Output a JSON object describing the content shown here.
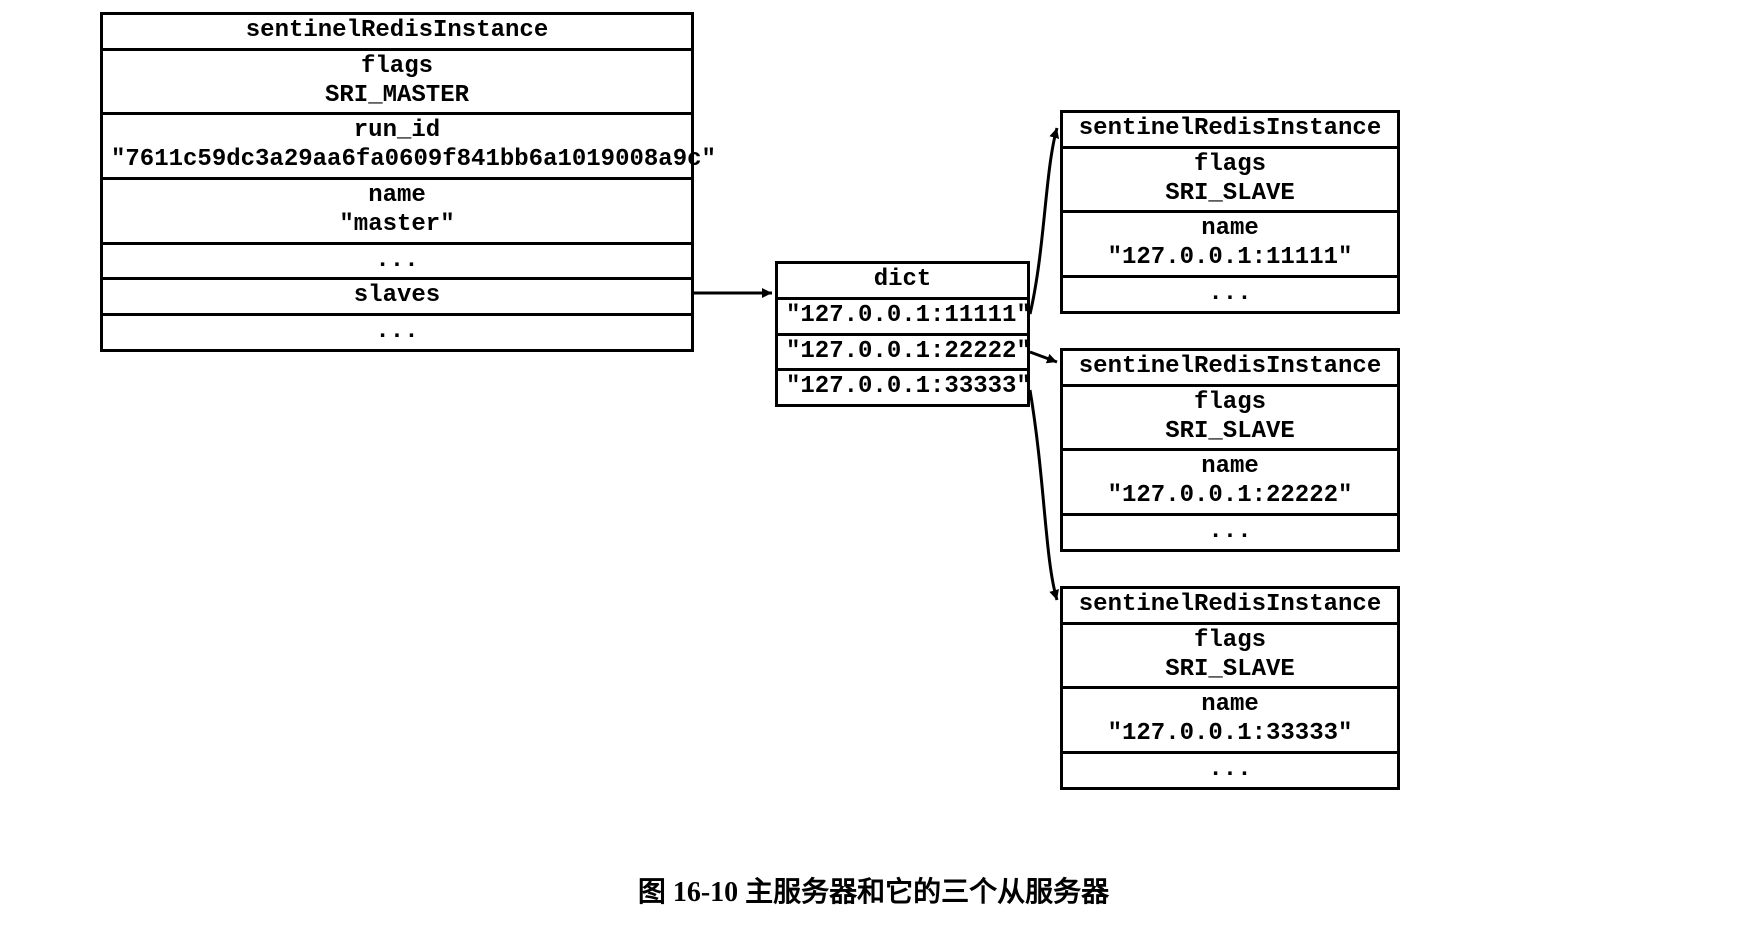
{
  "master": {
    "title": "sentinelRedisInstance",
    "flags_label": "flags",
    "flags_value": "SRI_MASTER",
    "runid_label": "run_id",
    "runid_value": "\"7611c59dc3a29aa6fa0609f841bb6a1019008a9c\"",
    "name_label": "name",
    "name_value": "\"master\"",
    "dots1": "...",
    "slaves_label": "slaves",
    "dots2": "..."
  },
  "dict": {
    "title": "dict",
    "k1": "\"127.0.0.1:11111\"",
    "k2": "\"127.0.0.1:22222\"",
    "k3": "\"127.0.0.1:33333\""
  },
  "slave1": {
    "title": "sentinelRedisInstance",
    "flags_label": "flags",
    "flags_value": "SRI_SLAVE",
    "name_label": "name",
    "name_value": "\"127.0.0.1:11111\"",
    "dots": "..."
  },
  "slave2": {
    "title": "sentinelRedisInstance",
    "flags_label": "flags",
    "flags_value": "SRI_SLAVE",
    "name_label": "name",
    "name_value": "\"127.0.0.1:22222\"",
    "dots": "..."
  },
  "slave3": {
    "title": "sentinelRedisInstance",
    "flags_label": "flags",
    "flags_value": "SRI_SLAVE",
    "name_label": "name",
    "name_value": "\"127.0.0.1:33333\"",
    "dots": "..."
  },
  "caption": "图 16-10  主服务器和它的三个从服务器"
}
